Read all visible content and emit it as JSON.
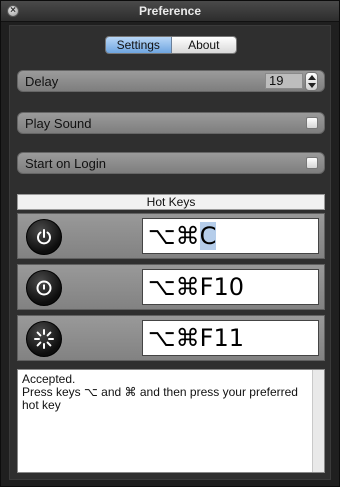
{
  "window": {
    "title": "Preference"
  },
  "tabs": [
    {
      "label": "Settings",
      "active": true
    },
    {
      "label": "About",
      "active": false
    }
  ],
  "settings": {
    "delay": {
      "label": "Delay",
      "value": "19"
    },
    "play_sound": {
      "label": "Play Sound",
      "checked": false
    },
    "start_on_login": {
      "label": "Start on Login",
      "checked": false
    }
  },
  "hotkeys": {
    "header": "Hot Keys",
    "items": [
      {
        "icon": "power-icon",
        "prefix": "⌥⌘",
        "key": "C",
        "key_selected": true
      },
      {
        "icon": "stop-circle-icon",
        "prefix": "⌥⌘",
        "key": "F10",
        "key_selected": false
      },
      {
        "icon": "spinner-icon",
        "prefix": "⌥⌘",
        "key": "F11",
        "key_selected": false
      }
    ]
  },
  "messages": [
    "Accepted.",
    "Press keys ⌥ and ⌘ and then press your preferred hot key"
  ],
  "colors": {
    "tab_active": "#6fa5e0",
    "selection": "#b5cdea",
    "row_bg": "#8e8e8e"
  }
}
